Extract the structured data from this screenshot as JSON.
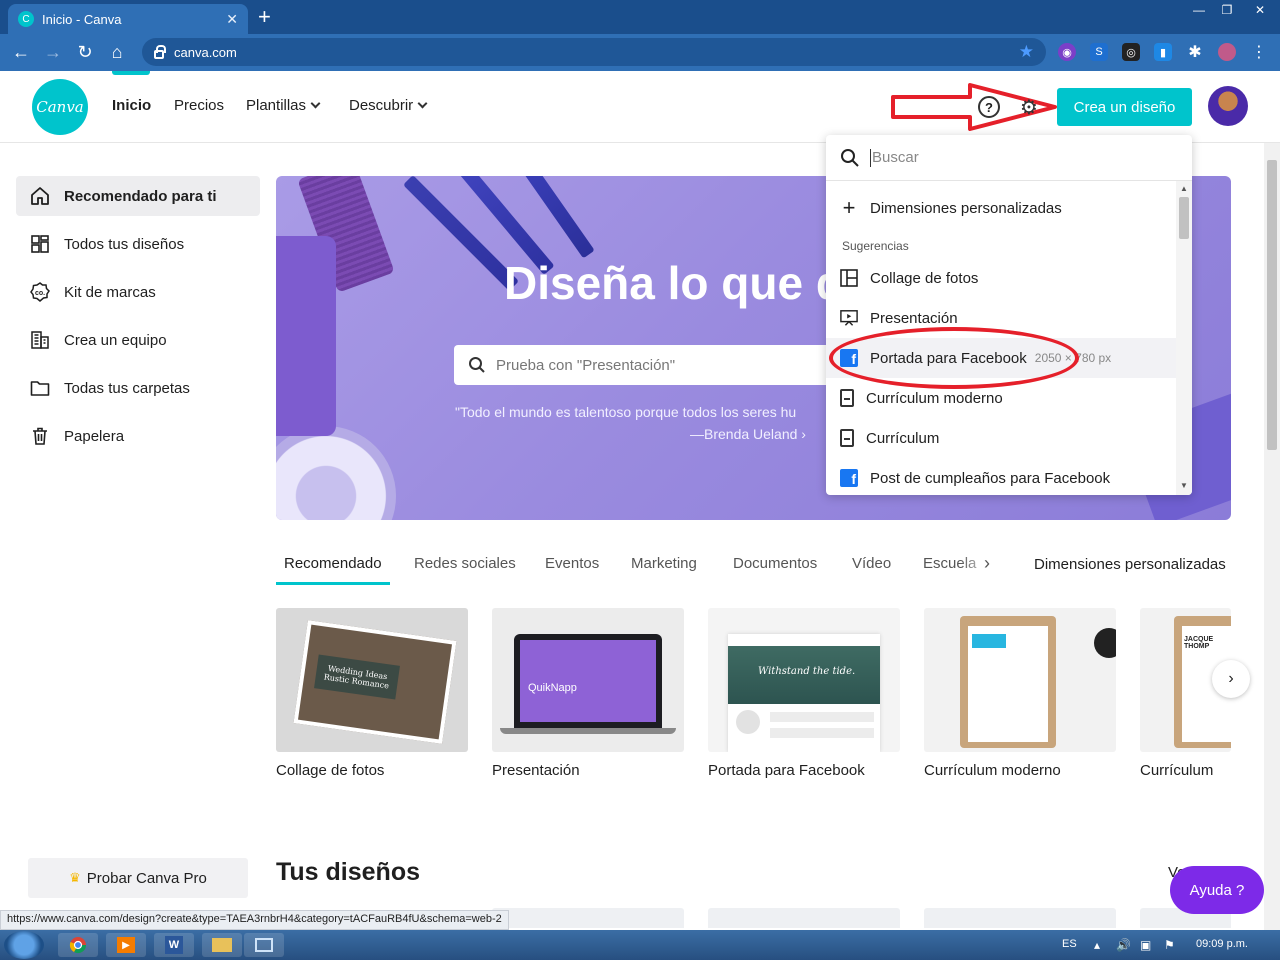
{
  "browser": {
    "tab_title": "Inicio - Canva",
    "tab_favicon": "C",
    "tab_close": "✕",
    "new_tab": "+",
    "url": "canva.com",
    "status_url": "https://www.canva.com/design?create&type=TAEA3rnbrH4&category=tACFauRB4fU&schema=web-2",
    "window_controls": [
      "—",
      "❐",
      "✕"
    ]
  },
  "header": {
    "logo_text": "Canva",
    "nav": [
      "Inicio",
      "Precios",
      "Plantillas",
      "Descubrir"
    ],
    "create_button": "Crea un diseño",
    "help_icon": "?",
    "gear_icon": "⚙",
    "accent_color": "#00c4cc"
  },
  "sidebar": {
    "items": [
      {
        "label": "Recomendado para ti",
        "icon": "home-icon"
      },
      {
        "label": "Todos tus diseños",
        "icon": "grid-icon"
      },
      {
        "label": "Kit de marcas",
        "icon": "brand-kit-icon"
      },
      {
        "label": "Crea un equipo",
        "icon": "building-icon"
      },
      {
        "label": "Todas tus carpetas",
        "icon": "folder-icon"
      },
      {
        "label": "Papelera",
        "icon": "trash-icon"
      }
    ],
    "pro_button": "Probar Canva Pro"
  },
  "hero": {
    "title": "Diseña lo que q",
    "search_placeholder": "Prueba con \"Presentación\"",
    "quote": "\"Todo el mundo es talentoso porque todos los seres hu",
    "author": "—Brenda Ueland ›"
  },
  "dropdown": {
    "search_placeholder": "Buscar",
    "custom": "Dimensiones personalizadas",
    "section": "Sugerencias",
    "items": [
      {
        "label": "Collage de fotos",
        "icon": "collage-icon",
        "dims": ""
      },
      {
        "label": "Presentación",
        "icon": "presentation-icon",
        "dims": ""
      },
      {
        "label": "Portada para Facebook",
        "icon": "facebook-icon",
        "dims": "2050 × 780 px"
      },
      {
        "label": "Currículum moderno",
        "icon": "document-icon",
        "dims": ""
      },
      {
        "label": "Currículum",
        "icon": "document-icon",
        "dims": ""
      },
      {
        "label": "Post de cumpleaños para Facebook",
        "icon": "facebook-icon",
        "dims": ""
      }
    ]
  },
  "categories": {
    "tabs": [
      "Recomendado",
      "Redes sociales",
      "Eventos",
      "Marketing",
      "Documentos",
      "Vídeo",
      "Escuela"
    ],
    "custom": "Dimensiones personalizadas"
  },
  "templates": [
    {
      "label": "Collage de fotos",
      "thumb_text": "Wedding Ideas Rustic Romance"
    },
    {
      "label": "Presentación",
      "thumb_text": "QuikNapp"
    },
    {
      "label": "Portada para Facebook",
      "thumb_text": "Withstand the tide."
    },
    {
      "label": "Currículum moderno",
      "thumb_text": ""
    },
    {
      "label": "Currículum",
      "thumb_text": "JACQUE THOMP"
    }
  ],
  "your_designs": {
    "title": "Tus diseños",
    "see_all": "Ve"
  },
  "help_fab": "Ayuda  ?",
  "taskbar": {
    "lang": "ES",
    "time": "09:09 p.m."
  }
}
